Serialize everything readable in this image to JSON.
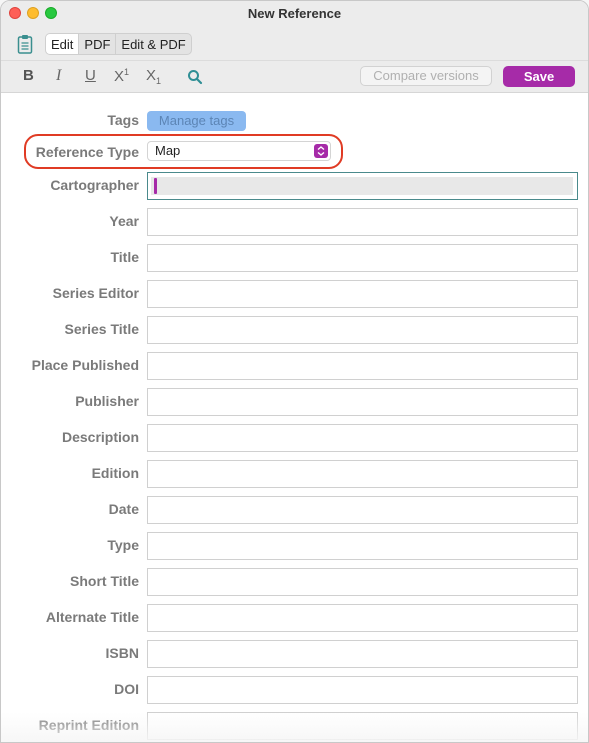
{
  "window": {
    "title": "New Reference"
  },
  "mode_tabs": [
    {
      "label": "Edit",
      "active": true
    },
    {
      "label": "PDF",
      "active": false
    },
    {
      "label": "Edit & PDF",
      "active": false
    }
  ],
  "format_toolbar": {
    "bold": "B",
    "italic": "I",
    "underline": "U",
    "superscript_base": "X",
    "superscript_mark": "1",
    "subscript_base": "X",
    "subscript_mark": "1",
    "compare_label": "Compare versions",
    "save_label": "Save"
  },
  "form": {
    "tags_label": "Tags",
    "manage_tags_label": "Manage tags",
    "reference_type_label": "Reference Type",
    "reference_type_value": "Map",
    "fields": [
      {
        "label": "Cartographer",
        "value": ""
      },
      {
        "label": "Year",
        "value": ""
      },
      {
        "label": "Title",
        "value": ""
      },
      {
        "label": "Series Editor",
        "value": ""
      },
      {
        "label": "Series Title",
        "value": ""
      },
      {
        "label": "Place Published",
        "value": ""
      },
      {
        "label": "Publisher",
        "value": ""
      },
      {
        "label": "Description",
        "value": ""
      },
      {
        "label": "Edition",
        "value": ""
      },
      {
        "label": "Date",
        "value": ""
      },
      {
        "label": "Type",
        "value": ""
      },
      {
        "label": "Short Title",
        "value": ""
      },
      {
        "label": "Alternate Title",
        "value": ""
      },
      {
        "label": "ISBN",
        "value": ""
      },
      {
        "label": "DOI",
        "value": ""
      },
      {
        "label": "Reprint Edition",
        "value": ""
      }
    ]
  },
  "colors": {
    "accent": "#a62ba8",
    "highlight_ring": "#e03b24",
    "tags_button": "#8ab9f0"
  }
}
